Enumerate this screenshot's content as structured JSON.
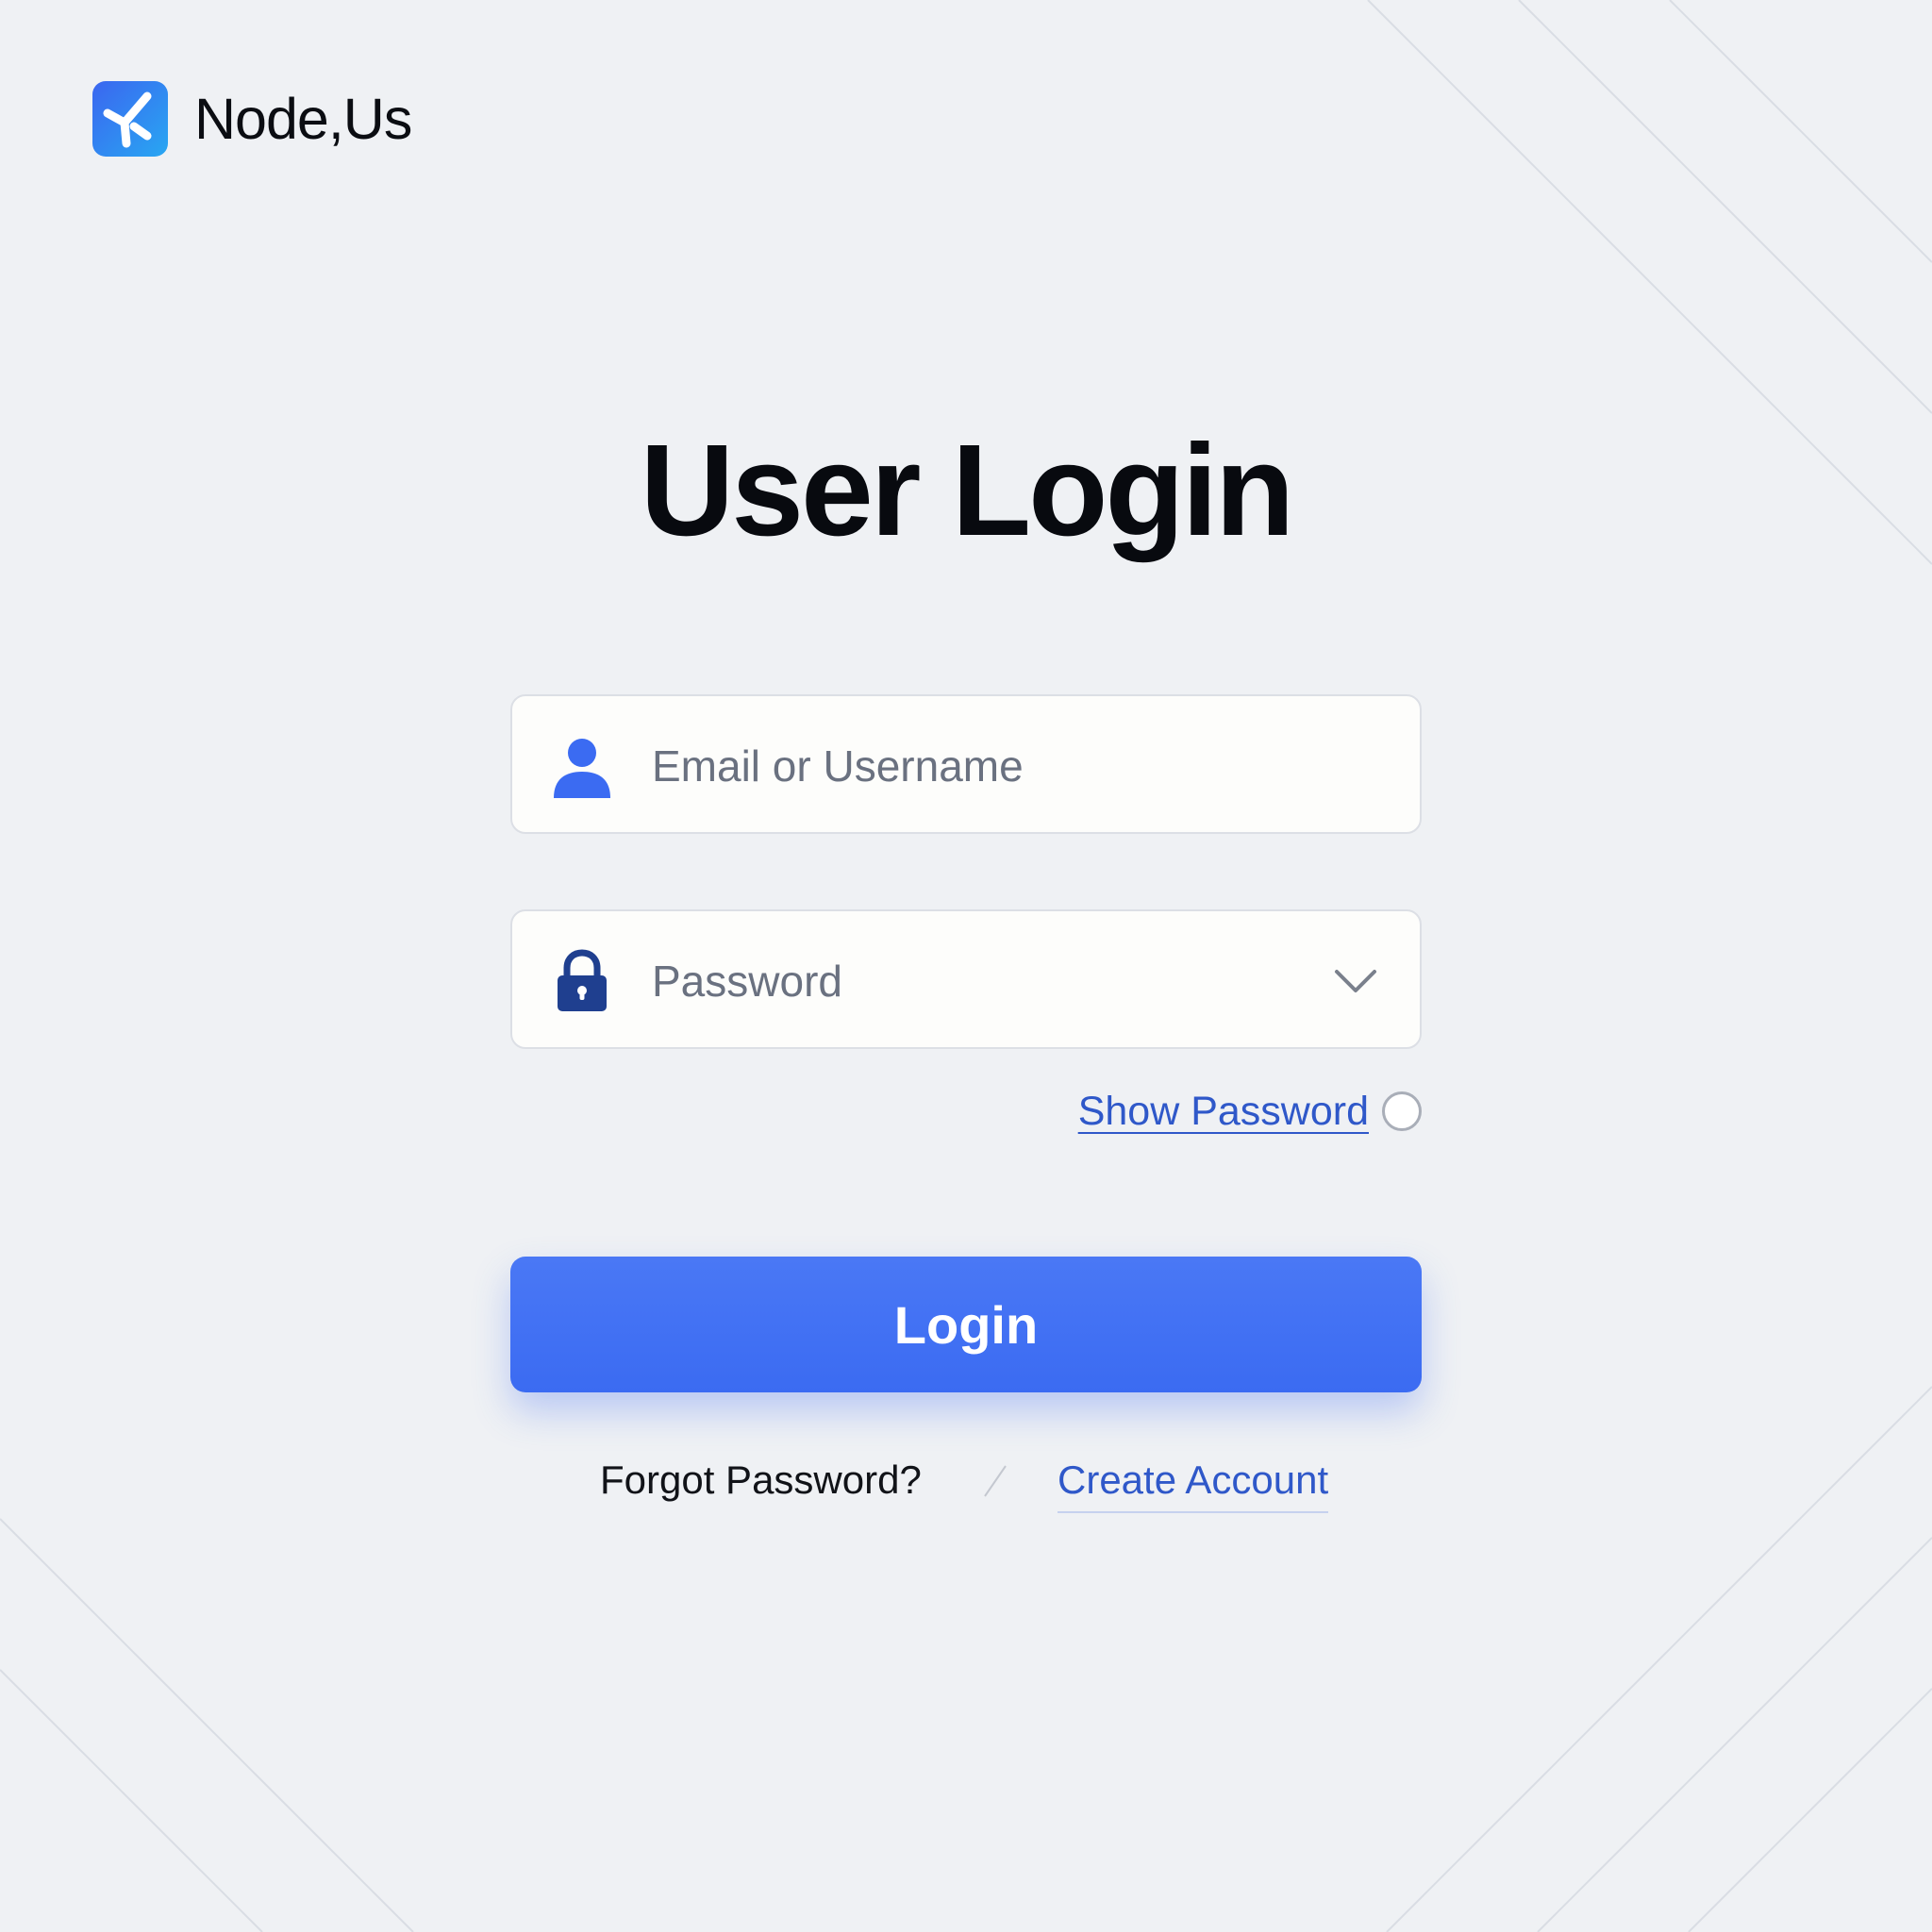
{
  "brand": {
    "name": "Node,Us",
    "logo_icon": "node-logo-icon",
    "accent_color": "#3b6bf2"
  },
  "page": {
    "title": "User Login"
  },
  "form": {
    "email": {
      "placeholder": "Email or Username",
      "value": "",
      "icon": "user-icon"
    },
    "password": {
      "placeholder": "Password",
      "value": "",
      "icon": "lock-icon",
      "trailing_icon": "chevron-down-icon"
    },
    "show_password": {
      "label": "Show Password",
      "checked": false
    },
    "login_label": "Login"
  },
  "links": {
    "forgot_password": "Forgot Password?",
    "create_account": "Create Account"
  },
  "colors": {
    "background": "#eff1f4",
    "primary_button": "#3b6bf2",
    "link": "#2f58c9",
    "icon_user": "#3b6bf2",
    "icon_lock": "#1f3f8f"
  }
}
